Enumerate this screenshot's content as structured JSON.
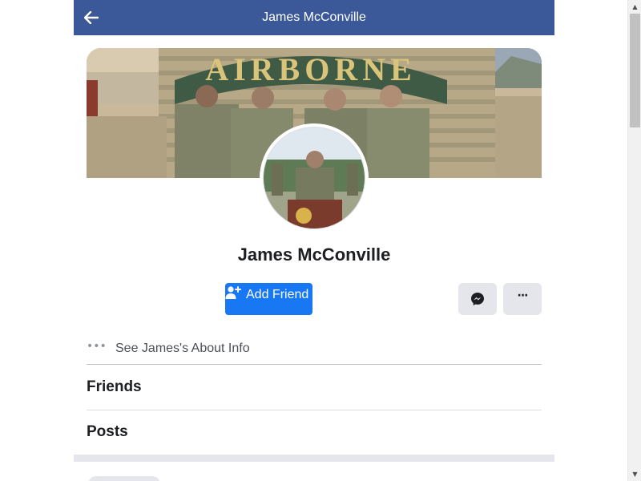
{
  "header": {
    "title": "James McConville",
    "back_icon": "arrow-left-icon",
    "background": "#3b5998"
  },
  "cover": {
    "banner_text": "AIRBORNE"
  },
  "profile": {
    "name": "James McConville"
  },
  "actions": {
    "add_friend_label": "Add Friend",
    "add_friend_icon": "person-add-icon",
    "messenger_icon": "messenger-icon",
    "more_label": "···",
    "accent": "#1877f2"
  },
  "about": {
    "dots": "•••",
    "label": "See James's About Info"
  },
  "sections": {
    "friends_title": "Friends",
    "posts_title": "Posts"
  },
  "scrollbar": {
    "up_arrow": "▲",
    "down_arrow": "▼"
  }
}
